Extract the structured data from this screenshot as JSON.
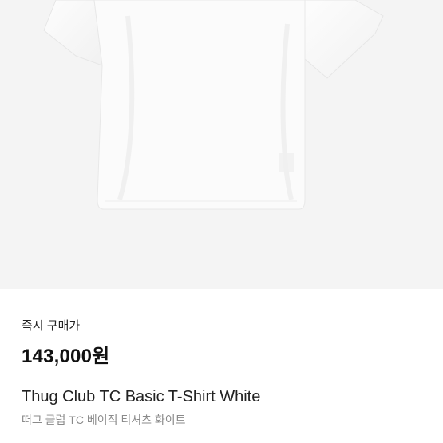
{
  "product": {
    "image_icon": "white-tshirt-image",
    "price_label": "즉시 구매가",
    "price": "143,000원",
    "name_en": "Thug Club TC Basic T-Shirt White",
    "name_ko": "떠그 클럽 TC 베이직 티셔츠 화이트"
  },
  "colors": {
    "image_background": "#f4f4f4",
    "shirt": "#fbfbfb",
    "price_text": "#111111",
    "subtitle_text": "#8a8a8a"
  }
}
